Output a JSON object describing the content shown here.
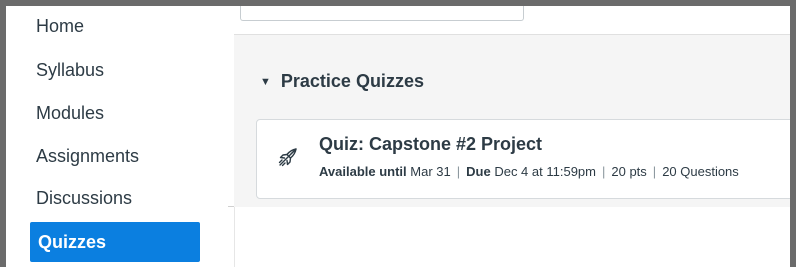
{
  "sidebar": {
    "items": [
      {
        "label": "Home",
        "active": false
      },
      {
        "label": "Syllabus",
        "active": false
      },
      {
        "label": "Modules",
        "active": false
      },
      {
        "label": "Assignments",
        "active": false
      },
      {
        "label": "Discussions",
        "active": false
      },
      {
        "label": "Quizzes",
        "active": true
      }
    ]
  },
  "module": {
    "title": "Practice Quizzes",
    "items": [
      {
        "icon": "rocket-quiz-icon",
        "title": "Quiz: Capstone #2 Project",
        "available_label": "Available until",
        "available_value": "Mar 31",
        "due_label": "Due",
        "due_value": "Dec 4 at 11:59pm",
        "points": "20 pts",
        "questions": "20 Questions"
      }
    ]
  },
  "colors": {
    "accent": "#0b7fe0",
    "text": "#2d3b45",
    "module_bg": "#f5f5f5"
  }
}
